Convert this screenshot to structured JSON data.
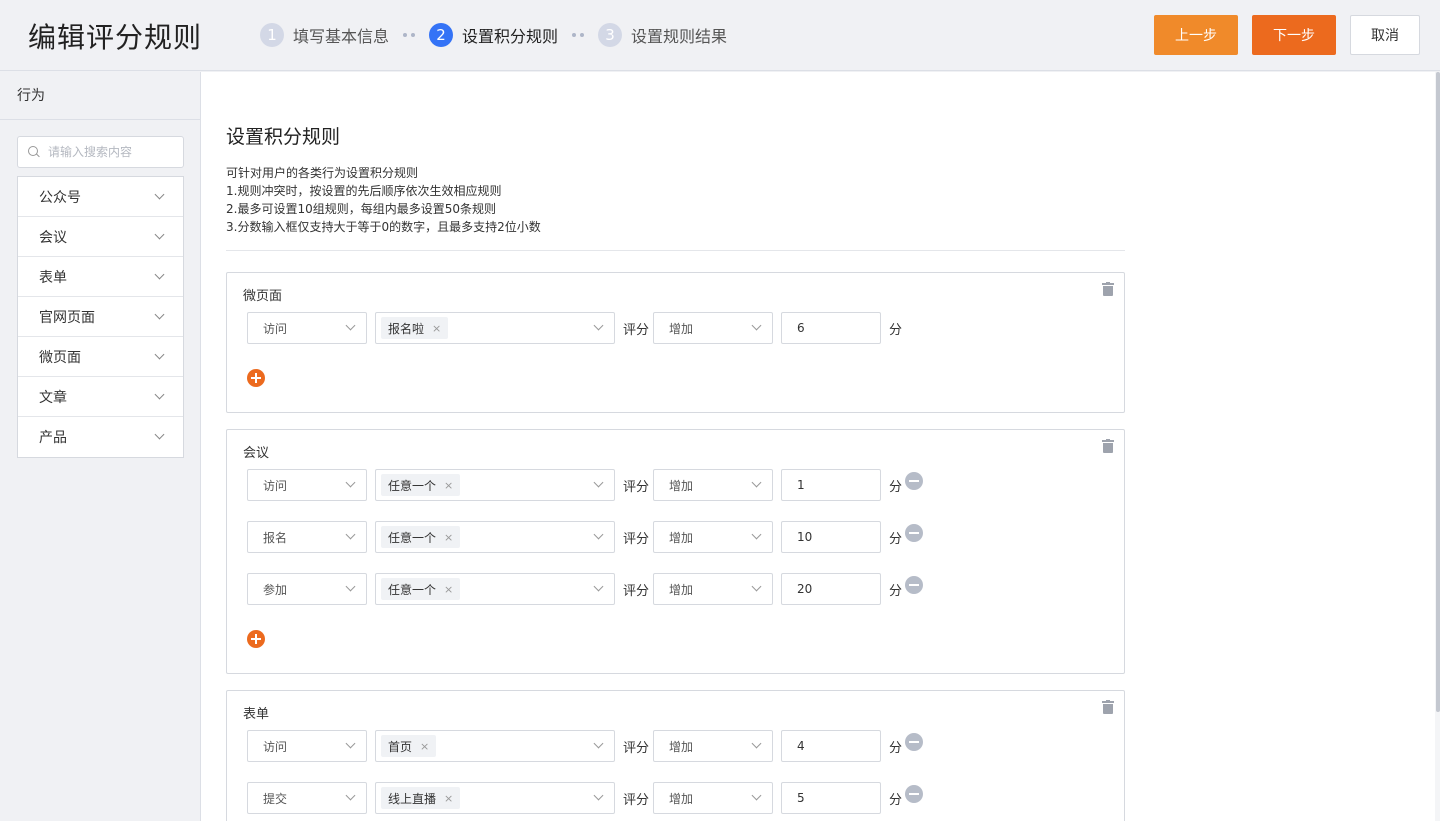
{
  "header": {
    "title": "编辑评分规则",
    "steps": [
      {
        "num": "1",
        "label": "填写基本信息"
      },
      {
        "num": "2",
        "label": "设置积分规则"
      },
      {
        "num": "3",
        "label": "设置规则结果"
      }
    ],
    "active_step": 2,
    "prev_label": "上一步",
    "next_label": "下一步",
    "cancel_label": "取消"
  },
  "sidebar": {
    "title": "行为",
    "search_placeholder": "请输入搜索内容",
    "items": [
      {
        "label": "公众号"
      },
      {
        "label": "会议"
      },
      {
        "label": "表单"
      },
      {
        "label": "官网页面"
      },
      {
        "label": "微页面"
      },
      {
        "label": "文章"
      },
      {
        "label": "产品"
      }
    ]
  },
  "main": {
    "title": "设置积分规则",
    "desc": [
      "可针对用户的各类行为设置积分规则",
      "1.规则冲突时，按设置的先后顺序依次生效相应规则",
      "2.最多可设置10组规则，每组内最多设置50条规则",
      "3.分数输入框仅支持大于等于0的数字，且最多支持2位小数"
    ],
    "score_label": "评分",
    "unit_label": "分",
    "groups": [
      {
        "title": "微页面",
        "rules": [
          {
            "action": "访问",
            "target": "报名啦",
            "op": "增加",
            "value": "6"
          }
        ]
      },
      {
        "title": "会议",
        "rules": [
          {
            "action": "访问",
            "target": "任意一个",
            "op": "增加",
            "value": "1"
          },
          {
            "action": "报名",
            "target": "任意一个",
            "op": "增加",
            "value": "10"
          },
          {
            "action": "参加",
            "target": "任意一个",
            "op": "增加",
            "value": "20"
          }
        ]
      },
      {
        "title": "表单",
        "rules": [
          {
            "action": "访问",
            "target": "首页",
            "op": "增加",
            "value": "4"
          },
          {
            "action": "提交",
            "target": "线上直播",
            "op": "增加",
            "value": "5"
          }
        ]
      }
    ]
  },
  "colors": {
    "primary": "#3473f6",
    "accent": "#ec6a1e",
    "prev_button": "#f08a2a"
  }
}
